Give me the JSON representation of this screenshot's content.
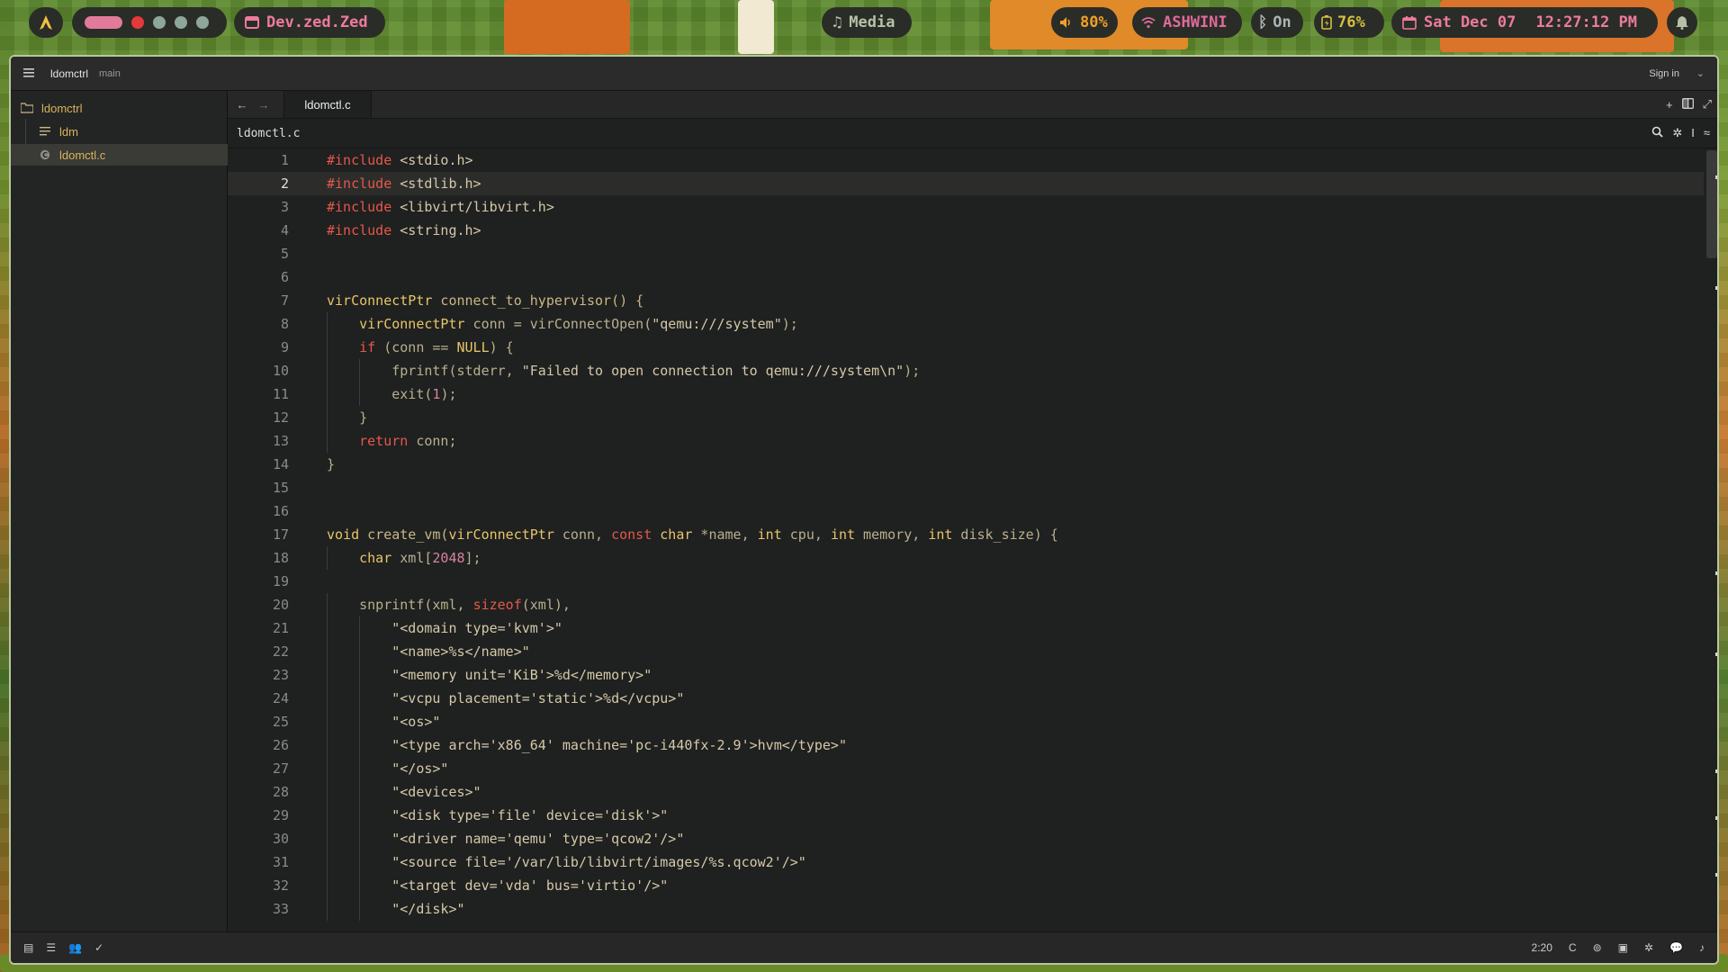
{
  "topbar": {
    "workspaces": {
      "active_color": "#e27a9c",
      "dot_colors": [
        "#e5393b",
        "#8fa79a",
        "#8fa79a",
        "#8fa79a"
      ]
    },
    "app_name": "Dev.zed.Zed",
    "media_label": "Media",
    "volume": "80%",
    "wifi": "ASHWINI",
    "bluetooth": "On",
    "battery": "76%",
    "date": "Sat Dec 07",
    "time": "12:27:12 PM"
  },
  "titlebar": {
    "project": "ldomctrl",
    "branch": "main",
    "sign_in": "Sign in"
  },
  "sidebar": {
    "root": "ldomctrl",
    "items": [
      "ldm",
      "ldomctl.c"
    ]
  },
  "tabs": {
    "active": "ldomctl.c"
  },
  "breadcrumb": "ldomctl.c",
  "editor": {
    "current_line": 2,
    "lines": [
      [
        [
          "#include",
          "pre"
        ],
        [
          " <stdio.h>",
          "str"
        ]
      ],
      [
        [
          "#include",
          "pre"
        ],
        [
          " <stdlib.h>",
          "str"
        ]
      ],
      [
        [
          "#include",
          "pre"
        ],
        [
          " <libvirt/libvirt.h>",
          "str"
        ]
      ],
      [
        [
          "#include",
          "pre"
        ],
        [
          " <string.h>",
          "str"
        ]
      ],
      [],
      [],
      [
        [
          "virConnectPtr",
          "type"
        ],
        [
          " connect_to_hypervisor() {",
          "fn"
        ]
      ],
      [
        [
          "    ",
          "plain"
        ],
        [
          "virConnectPtr",
          "type"
        ],
        [
          " conn = virConnectOpen(",
          "plain"
        ],
        [
          "\"qemu:///system\"",
          "str"
        ],
        [
          ");",
          "plain"
        ]
      ],
      [
        [
          "    ",
          "plain"
        ],
        [
          "if",
          "kw"
        ],
        [
          " (conn == ",
          "plain"
        ],
        [
          "NULL",
          "type"
        ],
        [
          ") {",
          "plain"
        ]
      ],
      [
        [
          "        fprintf(stderr, ",
          "plain"
        ],
        [
          "\"Failed to open connection to qemu:///system\\n\"",
          "str"
        ],
        [
          ");",
          "plain"
        ]
      ],
      [
        [
          "        exit(",
          "plain"
        ],
        [
          "1",
          "num"
        ],
        [
          ");",
          "plain"
        ]
      ],
      [
        [
          "    }",
          "plain"
        ]
      ],
      [
        [
          "    ",
          "plain"
        ],
        [
          "return",
          "kw"
        ],
        [
          " conn;",
          "plain"
        ]
      ],
      [
        [
          "}",
          "plain"
        ]
      ],
      [],
      [],
      [
        [
          "void",
          "type"
        ],
        [
          " create_vm(",
          "fn"
        ],
        [
          "virConnectPtr",
          "type"
        ],
        [
          " conn, ",
          "plain"
        ],
        [
          "const",
          "kw"
        ],
        [
          " ",
          "plain"
        ],
        [
          "char",
          "type"
        ],
        [
          " *name, ",
          "plain"
        ],
        [
          "int",
          "type"
        ],
        [
          " cpu, ",
          "plain"
        ],
        [
          "int",
          "type"
        ],
        [
          " memory, ",
          "plain"
        ],
        [
          "int",
          "type"
        ],
        [
          " disk_size) {",
          "plain"
        ]
      ],
      [
        [
          "    ",
          "plain"
        ],
        [
          "char",
          "type"
        ],
        [
          " xml[",
          "plain"
        ],
        [
          "2048",
          "num"
        ],
        [
          "];",
          "plain"
        ]
      ],
      [],
      [
        [
          "    snprintf(xml, ",
          "plain"
        ],
        [
          "sizeof",
          "kw"
        ],
        [
          "(xml),",
          "plain"
        ]
      ],
      [
        [
          "        ",
          "plain"
        ],
        [
          "\"<domain type='kvm'>\"",
          "str"
        ]
      ],
      [
        [
          "        ",
          "plain"
        ],
        [
          "\"<name>%s</name>\"",
          "str"
        ]
      ],
      [
        [
          "        ",
          "plain"
        ],
        [
          "\"<memory unit='KiB'>%d</memory>\"",
          "str"
        ]
      ],
      [
        [
          "        ",
          "plain"
        ],
        [
          "\"<vcpu placement='static'>%d</vcpu>\"",
          "str"
        ]
      ],
      [
        [
          "        ",
          "plain"
        ],
        [
          "\"<os>\"",
          "str"
        ]
      ],
      [
        [
          "        ",
          "plain"
        ],
        [
          "\"<type arch='x86_64' machine='pc-i440fx-2.9'>hvm</type>\"",
          "str"
        ]
      ],
      [
        [
          "        ",
          "plain"
        ],
        [
          "\"</os>\"",
          "str"
        ]
      ],
      [
        [
          "        ",
          "plain"
        ],
        [
          "\"<devices>\"",
          "str"
        ]
      ],
      [
        [
          "        ",
          "plain"
        ],
        [
          "\"<disk type='file' device='disk'>\"",
          "str"
        ]
      ],
      [
        [
          "        ",
          "plain"
        ],
        [
          "\"<driver name='qemu' type='qcow2'/>\"",
          "str"
        ]
      ],
      [
        [
          "        ",
          "plain"
        ],
        [
          "\"<source file='/var/lib/libvirt/images/%s.qcow2'/>\"",
          "str"
        ]
      ],
      [
        [
          "        ",
          "plain"
        ],
        [
          "\"<target dev='vda' bus='virtio'/>\"",
          "str"
        ]
      ],
      [
        [
          "        ",
          "plain"
        ],
        [
          "\"</disk>\"",
          "str"
        ]
      ]
    ]
  },
  "statusbar": {
    "cursor": "2:20",
    "language": "C"
  }
}
